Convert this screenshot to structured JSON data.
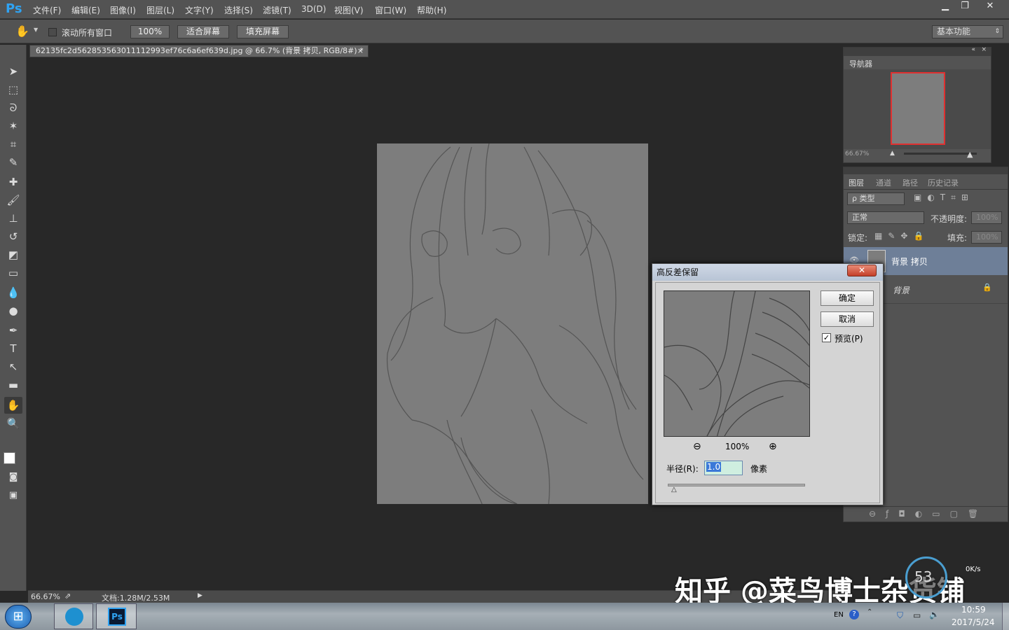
{
  "app": {
    "logo": "Ps"
  },
  "menu": [
    "文件(F)",
    "编辑(E)",
    "图像(I)",
    "图层(L)",
    "文字(Y)",
    "选择(S)",
    "滤镜(T)",
    "3D(D)",
    "视图(V)",
    "窗口(W)",
    "帮助(H)"
  ],
  "window_controls": {
    "minimize": "▁",
    "restore": "❐",
    "close": "✕"
  },
  "options": {
    "scroll_all_label": "滚动所有窗口",
    "zoom_100": "100%",
    "fit_screen": "适合屏幕",
    "fill_screen": "填充屏幕",
    "workspace": "基本功能"
  },
  "document": {
    "tab_title": "62135fc2d562853563011112993ef76c6a6ef639d.jpg @ 66.7% (背景 拷贝, RGB/8#) *",
    "close": "×"
  },
  "status": {
    "zoom": "66.67%",
    "doc_size": "文档:1.28M/2.53M"
  },
  "navigator": {
    "title": "导航器",
    "zoom": "66.67%"
  },
  "layers_panel": {
    "tabs": [
      "图层",
      "通道",
      "路径",
      "历史记录"
    ],
    "filter_type": "ρ 类型",
    "blend_mode": "正常",
    "opacity_label": "不透明度:",
    "opacity_value": "100%",
    "lock_label": "锁定:",
    "fill_label": "填充:",
    "fill_value": "100%",
    "layers": [
      {
        "name": "背景 拷贝",
        "selected": true
      },
      {
        "name": "背景",
        "selected": false
      }
    ]
  },
  "dialog": {
    "title": "高反差保留",
    "ok": "确定",
    "cancel": "取消",
    "preview_label": "预览(P)",
    "preview_checked": true,
    "zoom": "100%",
    "radius_label": "半径(R):",
    "radius_value": "1.0",
    "unit": "像素"
  },
  "taskbar": {
    "lang": "EN",
    "time": "10:59",
    "date": "2017/5/24",
    "net_speed": "0K/s",
    "net_percent": "53"
  },
  "watermark": "知乎 @菜鸟博士杂货铺",
  "icons": [
    "hand-icon",
    "move-icon",
    "marquee-icon",
    "lasso-icon",
    "magic-wand-icon",
    "crop-icon",
    "eyedropper-icon",
    "healing-icon",
    "brush-icon",
    "stamp-icon",
    "history-brush-icon",
    "eraser-icon",
    "gradient-icon",
    "blur-icon",
    "dodge-icon",
    "pen-icon",
    "type-icon",
    "path-select-icon",
    "shape-icon",
    "zoom-icon",
    "zoom-in-icon",
    "zoom-out-icon",
    "eye-icon",
    "lock-icon",
    "windows-start-icon",
    "ps-taskbar-icon"
  ]
}
